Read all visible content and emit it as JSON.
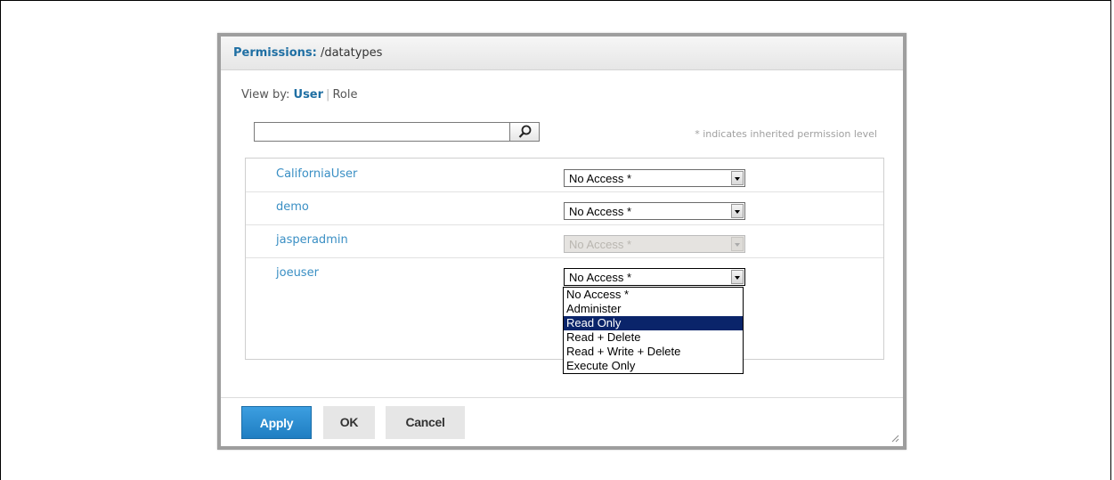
{
  "dialog": {
    "title_label": "Permissions:",
    "title_path": "/datatypes"
  },
  "view_by": {
    "label": "View by:",
    "user": "User",
    "separator": "|",
    "role": "Role"
  },
  "search": {
    "value": "",
    "placeholder": "",
    "icon": "search-icon"
  },
  "inherited_note": "* indicates inherited permission level",
  "rows": [
    {
      "user": "CaliforniaUser",
      "permission": "No Access *",
      "disabled": false
    },
    {
      "user": "demo",
      "permission": "No Access *",
      "disabled": false
    },
    {
      "user": "jasperadmin",
      "permission": "No Access *",
      "disabled": true
    },
    {
      "user": "joeuser",
      "permission": "No Access *",
      "disabled": false,
      "open": true
    }
  ],
  "dropdown": {
    "options": [
      "No Access *",
      "Administer",
      "Read Only",
      "Read + Delete",
      "Read + Write + Delete",
      "Execute Only"
    ],
    "highlighted": "Read Only"
  },
  "buttons": {
    "apply": "Apply",
    "ok": "OK",
    "cancel": "Cancel"
  },
  "colors": {
    "accent": "#1f6fa3",
    "link": "#3a8fc4",
    "apply_button": "#2a8bd0",
    "highlight": "#0a246a"
  }
}
